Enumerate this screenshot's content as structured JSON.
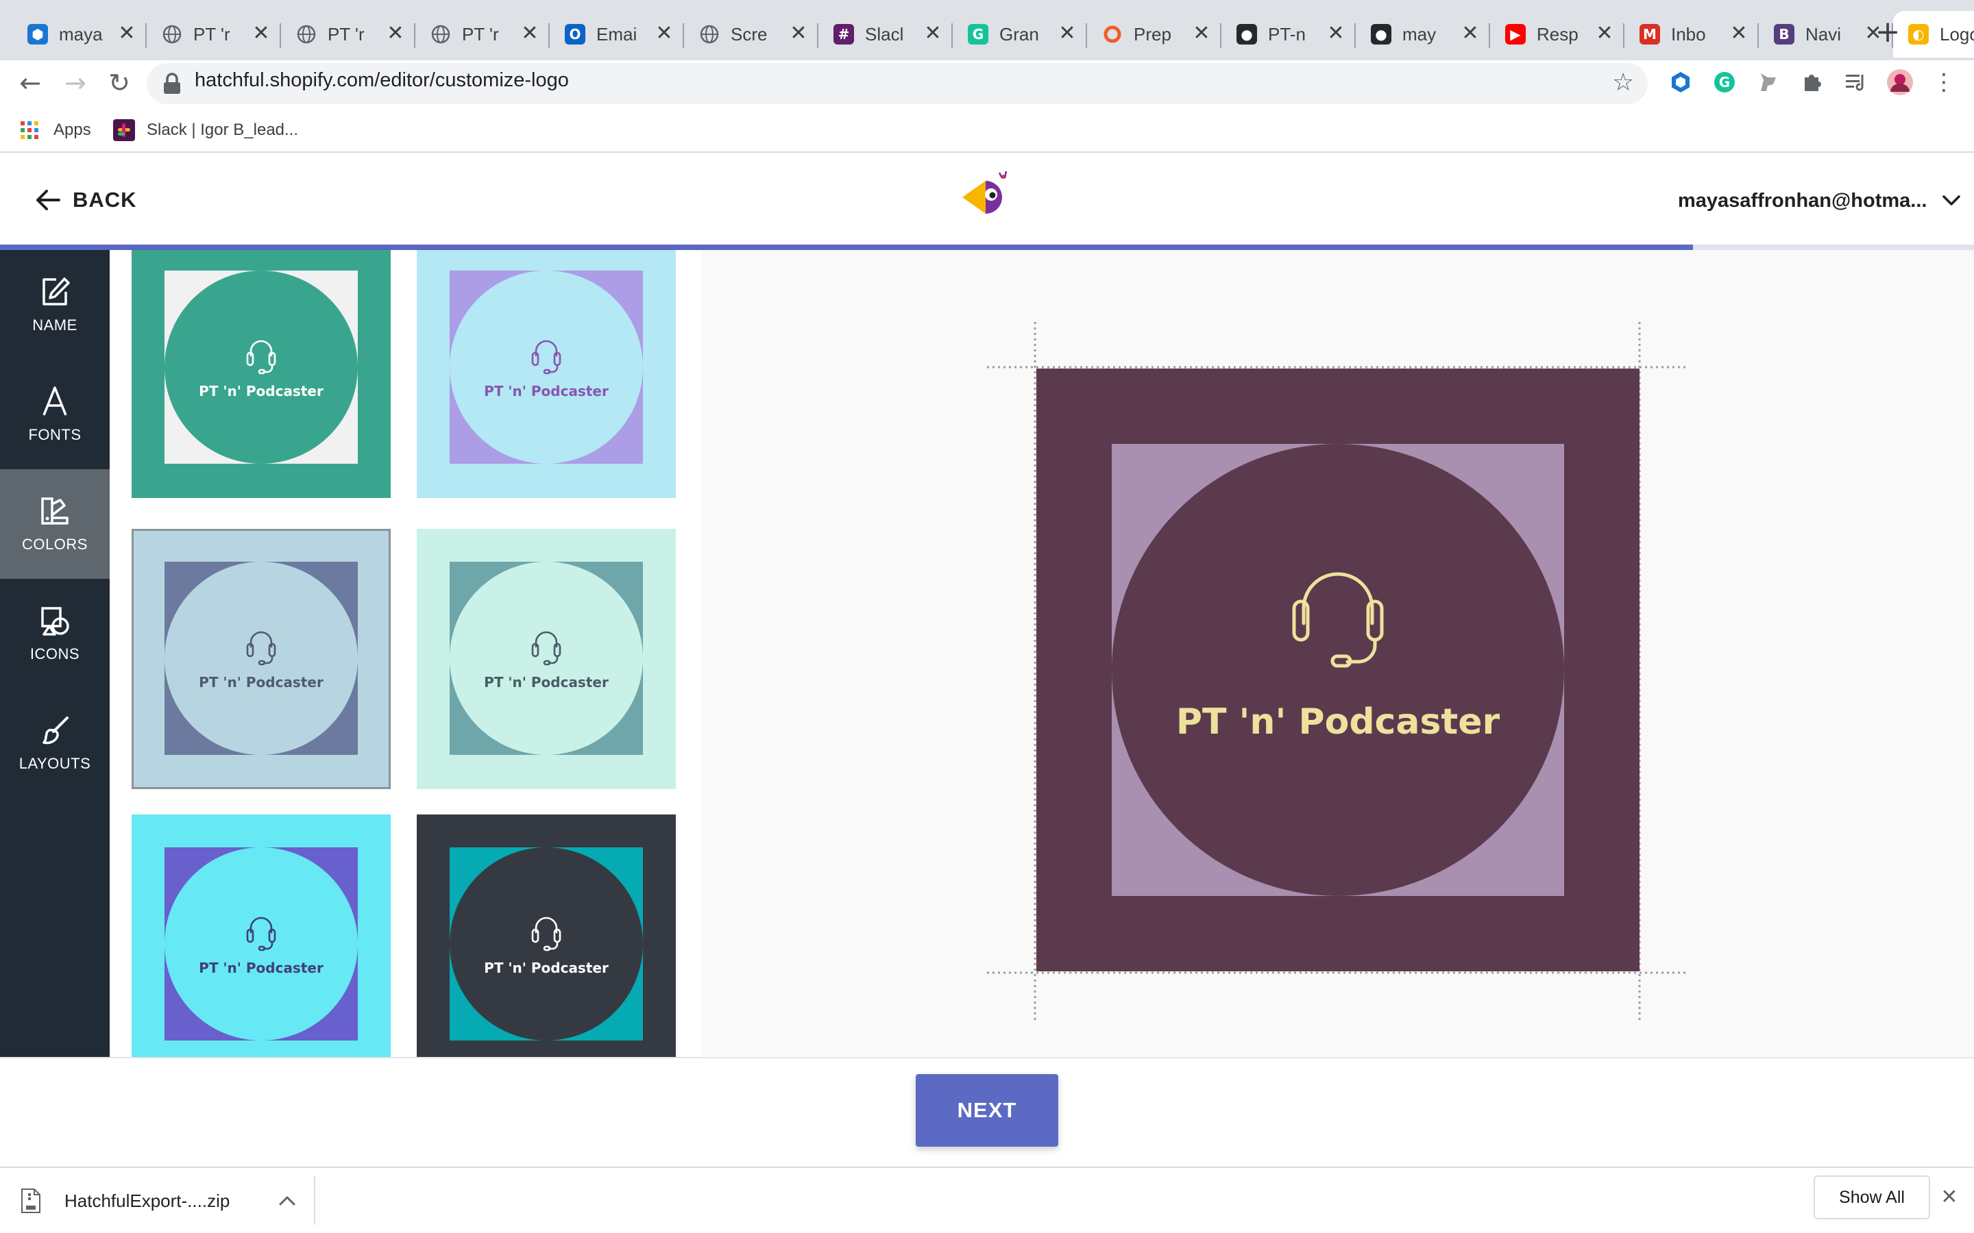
{
  "browser": {
    "tabs": [
      {
        "title": "maya",
        "icon": "hexagon-icon",
        "icon_color": "#1976d2"
      },
      {
        "title": "PT 'r",
        "icon": "globe-icon",
        "icon_color": "#5f6368"
      },
      {
        "title": "PT 'r",
        "icon": "globe-icon",
        "icon_color": "#5f6368"
      },
      {
        "title": "PT 'r",
        "icon": "globe-icon",
        "icon_color": "#5f6368"
      },
      {
        "title": "Emai",
        "icon": "outlook-icon",
        "icon_color": "#0a64c8"
      },
      {
        "title": "Scre",
        "icon": "globe-icon",
        "icon_color": "#5f6368"
      },
      {
        "title": "Slacl",
        "icon": "slack-icon",
        "icon_color": "#611f69"
      },
      {
        "title": "Gran",
        "icon": "grammarly-icon",
        "icon_color": "#15c39a"
      },
      {
        "title": "Prep",
        "icon": "ring-icon",
        "icon_color": "#f25c29"
      },
      {
        "title": "PT-n",
        "icon": "github-icon",
        "icon_color": "#24292e"
      },
      {
        "title": "may",
        "icon": "github-icon",
        "icon_color": "#24292e"
      },
      {
        "title": "Resp",
        "icon": "youtube-icon",
        "icon_color": "#ff0000"
      },
      {
        "title": "Inbo",
        "icon": "gmail-icon",
        "icon_color": "#d93025"
      },
      {
        "title": "Navi",
        "icon": "bootstrap-icon",
        "icon_color": "#563d7c"
      },
      {
        "title": "Logo",
        "icon": "hatchful-icon",
        "icon_color": "#f7b500",
        "active": true
      }
    ],
    "new_tab_glyph": "+",
    "close_glyph": "✕",
    "url": "hatchful.shopify.com/editor/customize-logo",
    "bookmarks": [
      {
        "label": "Apps",
        "icon": "apps-grid-icon"
      },
      {
        "label": "Slack | Igor B_lead...",
        "icon": "slack-icon"
      }
    ]
  },
  "header": {
    "back_label": "BACK",
    "account_label": "mayasaffronhan@hotma...",
    "progress_fraction": 0.8575
  },
  "sidebar": {
    "items": [
      {
        "label": "NAME",
        "icon": "edit-icon",
        "active": false
      },
      {
        "label": "FONTS",
        "icon": "font-icon",
        "active": false
      },
      {
        "label": "COLORS",
        "icon": "palette-icon",
        "active": true
      },
      {
        "label": "ICONS",
        "icon": "shapes-icon",
        "active": false
      },
      {
        "label": "LAYOUTS",
        "icon": "brush-icon",
        "active": false
      }
    ]
  },
  "swatches": [
    {
      "outer": "#3aa58e",
      "square": "#f1f1f1",
      "circle": "#3aa58e",
      "text": "#ffffff",
      "icon": "#ffffff"
    },
    {
      "outer": "#b3e8f4",
      "square": "#ac9de7",
      "circle": "#b3e8f4",
      "text": "#8855b0",
      "icon": "#8855b0"
    },
    {
      "outer": "#b7d5e0",
      "square": "#6b7a9e",
      "circle": "#b7d5e0",
      "text": "#505a73",
      "icon": "#505a73",
      "selected": true
    },
    {
      "outer": "#c9f1e7",
      "square": "#6fa6a9",
      "circle": "#c9f1e7",
      "text": "#4a5c66",
      "icon": "#4a5c66"
    },
    {
      "outer": "#67e8f5",
      "square": "#6860cc",
      "circle": "#67e8f5",
      "text": "#40407a",
      "icon": "#40407a"
    },
    {
      "outer": "#353a42",
      "square": "#05aab2",
      "circle": "#353a42",
      "text": "#ffffff",
      "icon": "#ffffff"
    }
  ],
  "logo_name": "PT 'n' Podcaster",
  "preview": {
    "background": "#5c3a4d",
    "square": "#a98fb0",
    "circle": "#5c3a4d",
    "accent": "#ece29d"
  },
  "footer": {
    "next_label": "NEXT"
  },
  "downloads": {
    "file_name": "HatchfulExport-....zip",
    "show_all_label": "Show All",
    "close_glyph": "✕"
  }
}
